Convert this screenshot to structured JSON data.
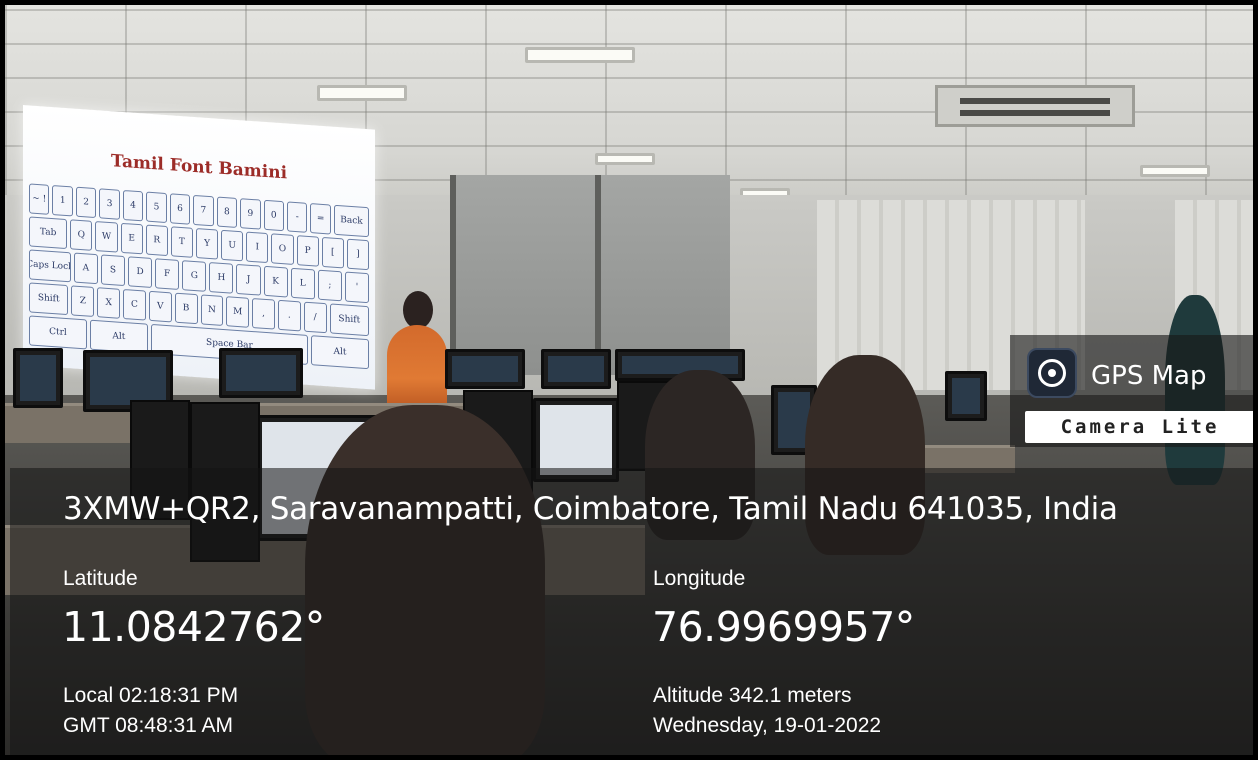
{
  "projector": {
    "title": "Tamil Font Bamini",
    "rows": [
      [
        "~ !",
        "1",
        "2",
        "3",
        "4",
        "5",
        "6",
        "7",
        "8",
        "9",
        "0",
        "-",
        "=",
        "Back"
      ],
      [
        "Tab",
        "Q",
        "W",
        "E",
        "R",
        "T",
        "Y",
        "U",
        "I",
        "O",
        "P",
        "[",
        "]"
      ],
      [
        "Caps Lock",
        "A",
        "S",
        "D",
        "F",
        "G",
        "H",
        "J",
        "K",
        "L",
        ";",
        "'"
      ],
      [
        "Shift",
        "Z",
        "X",
        "C",
        "V",
        "B",
        "N",
        "M",
        ",",
        ".",
        "/",
        "Shift"
      ],
      [
        "Ctrl",
        "Alt",
        "Space Bar",
        "Alt"
      ]
    ]
  },
  "badge": {
    "title": "GPS Map",
    "subtitle": "Camera Lite",
    "icon": "gps-target-icon"
  },
  "location": {
    "address": "3XMW+QR2, Saravanampatti, Coimbatore, Tamil Nadu 641035, India",
    "latitude_label": "Latitude",
    "latitude_value": "11.0842762°",
    "longitude_label": "Longitude",
    "longitude_value": "76.9969957°",
    "local_time": "Local 02:18:31 PM",
    "gmt_time": "GMT 08:48:31 AM",
    "altitude": "Altitude 342.1 meters",
    "date": "Wednesday, 19-01-2022"
  }
}
